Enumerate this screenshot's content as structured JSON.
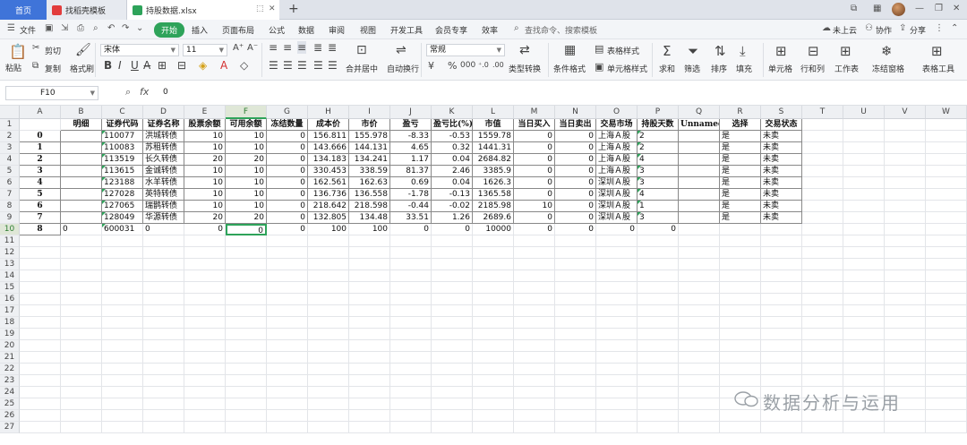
{
  "tabs": {
    "home": "首页",
    "templates": "找稻壳模板",
    "file": "持股数据.xlsx"
  },
  "menu": {
    "file": "文件",
    "start": "开始",
    "items": [
      "插入",
      "页面布局",
      "公式",
      "数据",
      "审阅",
      "视图",
      "开发工具",
      "会员专享",
      "效率"
    ],
    "search": "查找命令、搜索模板",
    "cloud": "未上云",
    "collab": "协作",
    "share": "分享"
  },
  "ribbon": {
    "paste": "粘贴",
    "cut": "剪切",
    "copy": "复制",
    "format_painter": "格式刷",
    "font": "宋体",
    "font_size": "11",
    "merge": "合并居中",
    "wrap": "自动换行",
    "number_format": "常规",
    "type_convert": "类型转换",
    "cond_format": "条件格式",
    "table_style": "表格样式",
    "cell_style": "单元格样式",
    "sum": "求和",
    "filter": "筛选",
    "sort": "排序",
    "fill": "填充",
    "cell": "单元格",
    "rowcol": "行和列",
    "sheet": "工作表",
    "freeze": "冻结窗格",
    "tools": "表格工具"
  },
  "formula_bar": {
    "name_box": "F10",
    "value": "0"
  },
  "grid": {
    "columns": [
      "A",
      "B",
      "C",
      "D",
      "E",
      "F",
      "G",
      "H",
      "I",
      "J",
      "K",
      "L",
      "M",
      "N",
      "O",
      "P",
      "Q",
      "R",
      "S",
      "T",
      "U",
      "V",
      "W"
    ],
    "rows": [
      "1",
      "2",
      "3",
      "4",
      "5",
      "6",
      "7",
      "8",
      "9",
      "10",
      "11",
      "12",
      "13",
      "14",
      "15",
      "16",
      "17",
      "18",
      "19",
      "20",
      "21",
      "22",
      "23",
      "24",
      "25",
      "26",
      "27"
    ],
    "selected_cell": "F10",
    "header": [
      "",
      "明细",
      "证券代码",
      "证券名称",
      "股票余额",
      "可用余额",
      "冻结数量",
      "成本价",
      "市价",
      "盈亏",
      "盈亏比(%)",
      "市值",
      "当日买入",
      "当日卖出",
      "交易市场",
      "持股天数",
      "Unnamed:",
      "选择",
      "交易状态"
    ],
    "data": [
      [
        "0",
        "",
        "110077",
        "洪城转债",
        "10",
        "10",
        "0",
        "156.811",
        "155.978",
        "-8.33",
        "-0.53",
        "1559.78",
        "0",
        "0",
        "上海Ａ股",
        "2",
        "",
        "是",
        "未卖"
      ],
      [
        "1",
        "",
        "110083",
        "苏租转债",
        "10",
        "10",
        "0",
        "143.666",
        "144.131",
        "4.65",
        "0.32",
        "1441.31",
        "0",
        "0",
        "上海Ａ股",
        "2",
        "",
        "是",
        "未卖"
      ],
      [
        "2",
        "",
        "113519",
        "长久转债",
        "20",
        "20",
        "0",
        "134.183",
        "134.241",
        "1.17",
        "0.04",
        "2684.82",
        "0",
        "0",
        "上海Ａ股",
        "4",
        "",
        "是",
        "未卖"
      ],
      [
        "3",
        "",
        "113615",
        "金诚转债",
        "10",
        "10",
        "0",
        "330.453",
        "338.59",
        "81.37",
        "2.46",
        "3385.9",
        "0",
        "0",
        "上海Ａ股",
        "3",
        "",
        "是",
        "未卖"
      ],
      [
        "4",
        "",
        "123188",
        "水羊转债",
        "10",
        "10",
        "0",
        "162.561",
        "162.63",
        "0.69",
        "0.04",
        "1626.3",
        "0",
        "0",
        "深圳Ａ股",
        "3",
        "",
        "是",
        "未卖"
      ],
      [
        "5",
        "",
        "127028",
        "英特转债",
        "10",
        "10",
        "0",
        "136.736",
        "136.558",
        "-1.78",
        "-0.13",
        "1365.58",
        "0",
        "0",
        "深圳Ａ股",
        "4",
        "",
        "是",
        "未卖"
      ],
      [
        "6",
        "",
        "127065",
        "瑞鹊转债",
        "10",
        "10",
        "0",
        "218.642",
        "218.598",
        "-0.44",
        "-0.02",
        "2185.98",
        "10",
        "0",
        "深圳Ａ股",
        "1",
        "",
        "是",
        "未卖"
      ],
      [
        "7",
        "",
        "128049",
        "华源转债",
        "20",
        "20",
        "0",
        "132.805",
        "134.48",
        "33.51",
        "1.26",
        "2689.6",
        "0",
        "0",
        "深圳Ａ股",
        "3",
        "",
        "是",
        "未卖"
      ],
      [
        "8",
        "0",
        "600031",
        "0",
        "0",
        "0",
        "0",
        "100",
        "100",
        "0",
        "0",
        "10000",
        "0",
        "0",
        "0",
        "0",
        "",
        "",
        ""
      ]
    ]
  },
  "watermark": "数据分析与运用"
}
